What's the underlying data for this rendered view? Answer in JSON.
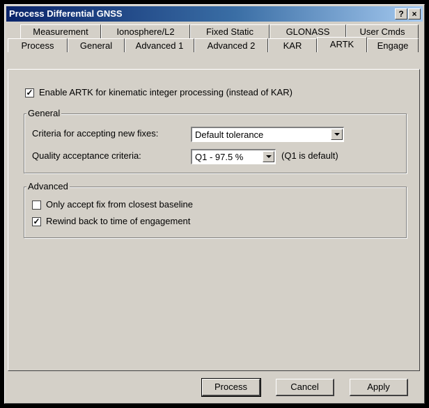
{
  "window": {
    "title": "Process Differential GNSS",
    "help_label": "?",
    "close_label": "×"
  },
  "tabs": {
    "row1": [
      "Measurement",
      "Ionosphere/L2",
      "Fixed Static",
      "GLONASS",
      "User Cmds"
    ],
    "row2": [
      "Process",
      "General",
      "Advanced 1",
      "Advanced 2",
      "KAR",
      "ARTK",
      "Engage"
    ],
    "active": "ARTK"
  },
  "artk": {
    "enable_label": "Enable ARTK for kinematic integer processing (instead of KAR)",
    "enable_checked": true
  },
  "general_group": {
    "legend": "General",
    "criteria_label": "Criteria for accepting new fixes:",
    "criteria_value": "Default tolerance",
    "quality_label": "Quality acceptance criteria:",
    "quality_value": "Q1 - 97.5 %",
    "quality_hint": "(Q1 is default)"
  },
  "advanced_group": {
    "legend": "Advanced",
    "closest_label": "Only accept fix from closest baseline",
    "closest_checked": false,
    "rewind_label": "Rewind back to time of engagement",
    "rewind_checked": true
  },
  "buttons": {
    "process": "Process",
    "cancel": "Cancel",
    "apply": "Apply"
  }
}
